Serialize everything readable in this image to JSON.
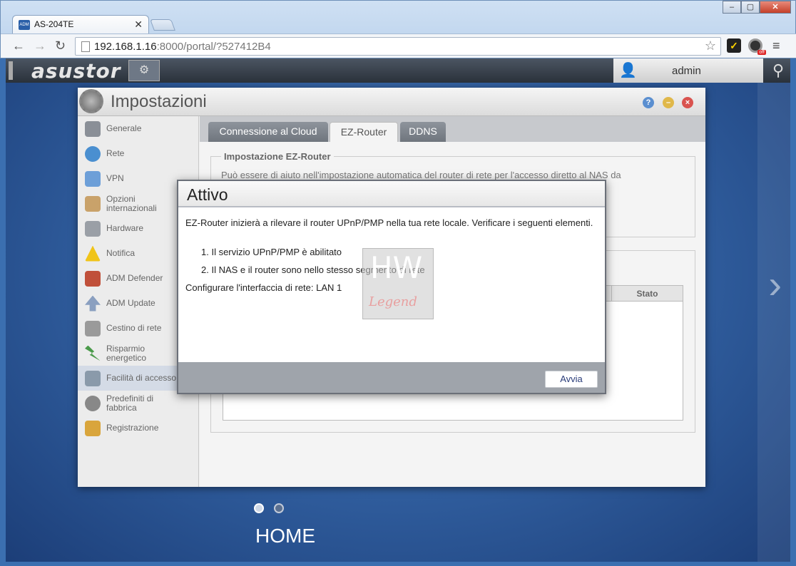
{
  "browser": {
    "tab_title": "AS-204TE",
    "tab_favicon": "ADM",
    "url_host": "192.168.1.16",
    "url_rest": ":8000/portal/?527412B4",
    "ext_badge": "off"
  },
  "adm": {
    "logo": "asustor",
    "user": "admin"
  },
  "window": {
    "title": "Impostazioni",
    "sidebar": [
      {
        "label": "Generale"
      },
      {
        "label": "Rete"
      },
      {
        "label": "VPN"
      },
      {
        "label": "Opzioni internazionali"
      },
      {
        "label": "Hardware"
      },
      {
        "label": "Notifica"
      },
      {
        "label": "ADM Defender"
      },
      {
        "label": "ADM Update"
      },
      {
        "label": "Cestino di rete"
      },
      {
        "label": "Risparmio energetico"
      },
      {
        "label": "Facilità di accesso"
      },
      {
        "label": "Predefiniti di fabbrica"
      },
      {
        "label": "Registrazione"
      }
    ],
    "tabs": [
      {
        "label": "Connessione al Cloud"
      },
      {
        "label": "EZ-Router"
      },
      {
        "label": "DDNS"
      }
    ],
    "section_title": "Impostazione EZ-Router",
    "section_text": "Può essere di aiuto nell'impostazione automatica del router di rete per l'accesso diretto al NAS da",
    "grid_header_status": "Stato"
  },
  "dialog": {
    "title": "Attivo",
    "intro": "EZ-Router inizierà a rilevare il router UPnP/PMP nella tua rete locale. Verificare i seguenti elementi.",
    "items": [
      "1. Il servizio UPnP/PMP è abilitato",
      "2. Il NAS e il router sono nello stesso segmento di rete"
    ],
    "config": "Configurare l'interfaccia di rete: LAN 1",
    "button": "Avvia",
    "watermark_top": "HW",
    "watermark_bottom": "Legend"
  },
  "desktop": {
    "label": "HOME"
  },
  "colors": {
    "accent": "#2a3d7a",
    "desktop_bg": "#2f5c9c"
  }
}
